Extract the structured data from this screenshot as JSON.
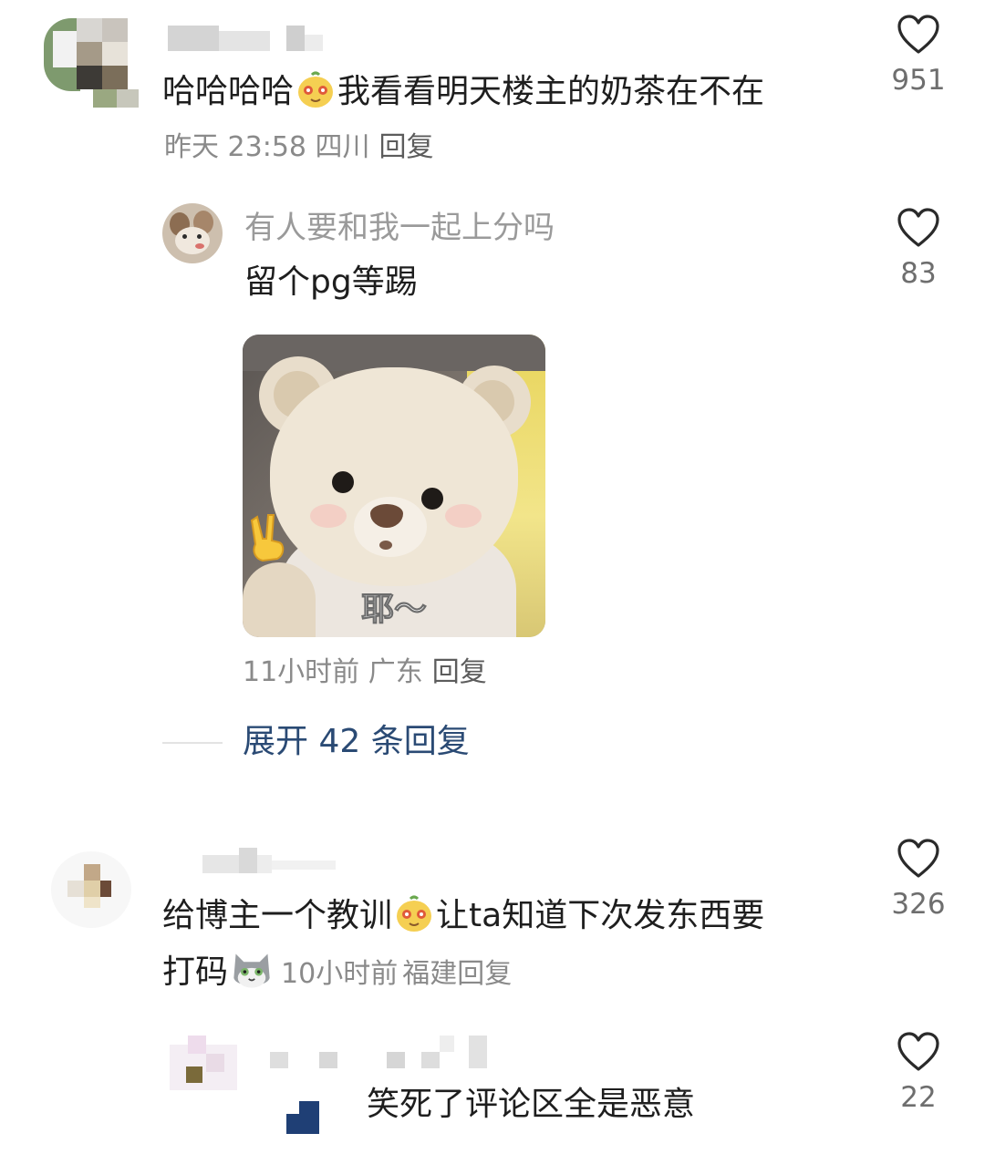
{
  "comments": [
    {
      "text_before": "哈哈哈哈",
      "emoji": "bear-face-emoji",
      "text_after": "我看看明天楼主的奶茶在不在",
      "time": "昨天 23:58",
      "location": "四川",
      "reply_label": "回复",
      "likes": "951"
    },
    {
      "username": "有人要和我一起上分吗",
      "text": "留个pg等踢",
      "sticker_caption": "耶～",
      "time": "11小时前",
      "location": "广东",
      "reply_label": "回复",
      "likes": "83"
    }
  ],
  "expand": {
    "label": "展开 42 条回复"
  },
  "comment3": {
    "text_line1_before": "给博主一个教训",
    "emoji1": "bear-face-emoji",
    "text_line1_after": "让ta知道下次发东西要",
    "text_line2": "打码",
    "emoji2": "cat-face-emoji",
    "time": "10小时前",
    "location": "福建",
    "reply_label": "回复",
    "likes": "326"
  },
  "comment4": {
    "text": "笑死了评论区全是恶意",
    "likes": "22"
  },
  "colors": {
    "like_outline": "#2a2a2a",
    "meta_gray": "#8a8a8a",
    "expand_blue": "#2a4a74"
  }
}
